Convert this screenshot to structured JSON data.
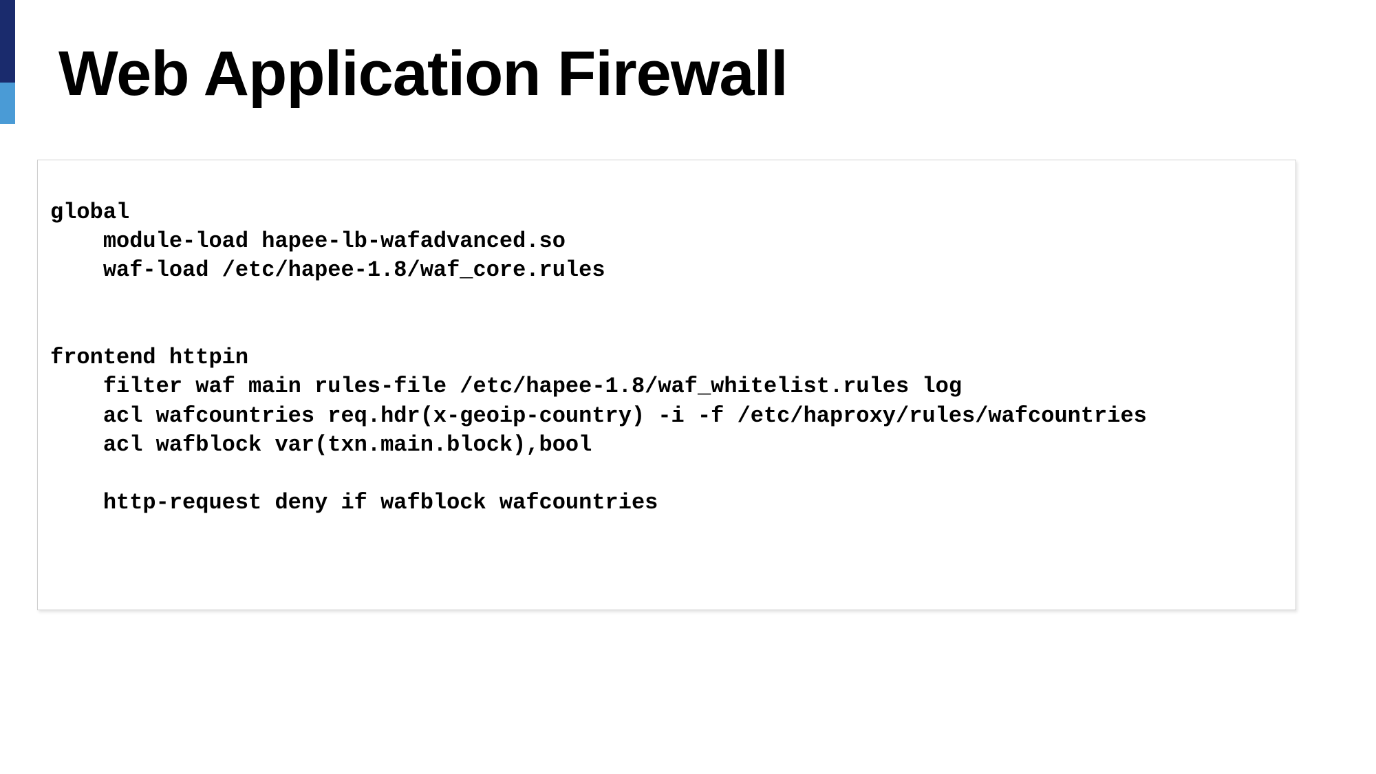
{
  "title": "Web Application Firewall",
  "code": "global\n    module-load hapee-lb-wafadvanced.so\n    waf-load /etc/hapee-1.8/waf_core.rules\n\n\nfrontend httpin\n    filter waf main rules-file /etc/hapee-1.8/waf_whitelist.rules log\n    acl wafcountries req.hdr(x-geoip-country) -i -f /etc/haproxy/rules/wafcountries\n    acl wafblock var(txn.main.block),bool\n\n    http-request deny if wafblock wafcountries"
}
